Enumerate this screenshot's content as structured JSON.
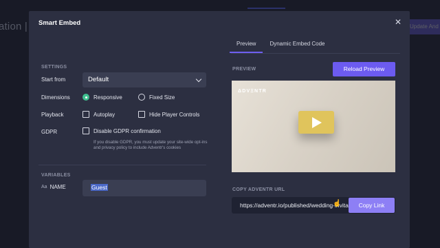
{
  "background": {
    "title": "ation | S",
    "button_label": "Update And"
  },
  "modal": {
    "title": "Smart Embed",
    "close_icon": "close-icon",
    "settings": {
      "section_label": "SETTINGS",
      "start_from": {
        "label": "Start from",
        "value": "Default"
      },
      "dimensions": {
        "label": "Dimensions",
        "options": [
          "Responsive",
          "Fixed Size"
        ],
        "selected": "Responsive"
      },
      "playback": {
        "label": "Playback",
        "options": [
          "Autoplay",
          "Hide Player Controls"
        ]
      },
      "gdpr": {
        "label": "GDPR",
        "option": "Disable GDPR confirmation",
        "note": "If you disable GDPR, you must update your site-wide opt-ins and privacy policy to include Adventr's cookies"
      }
    },
    "variables": {
      "section_label": "VARIABLES",
      "aa": "Aa",
      "name_label": "NAME",
      "name_value": "Guest"
    },
    "tabs": [
      "Preview",
      "Dynamic Embed Code"
    ],
    "active_tab": "Preview",
    "preview": {
      "section_label": "PREVIEW",
      "reload_label": "Reload Preview",
      "logo": "ΔDVΞNTR"
    },
    "copy": {
      "section_label": "COPY ADVENTR URL",
      "url": "https://adventr.io/published/wedding-invitation",
      "button_label": "Copy Link"
    }
  },
  "colors": {
    "accent": "#6c5bf0",
    "radio_on": "#3fbf8f",
    "play_button": "#e0c45c"
  }
}
